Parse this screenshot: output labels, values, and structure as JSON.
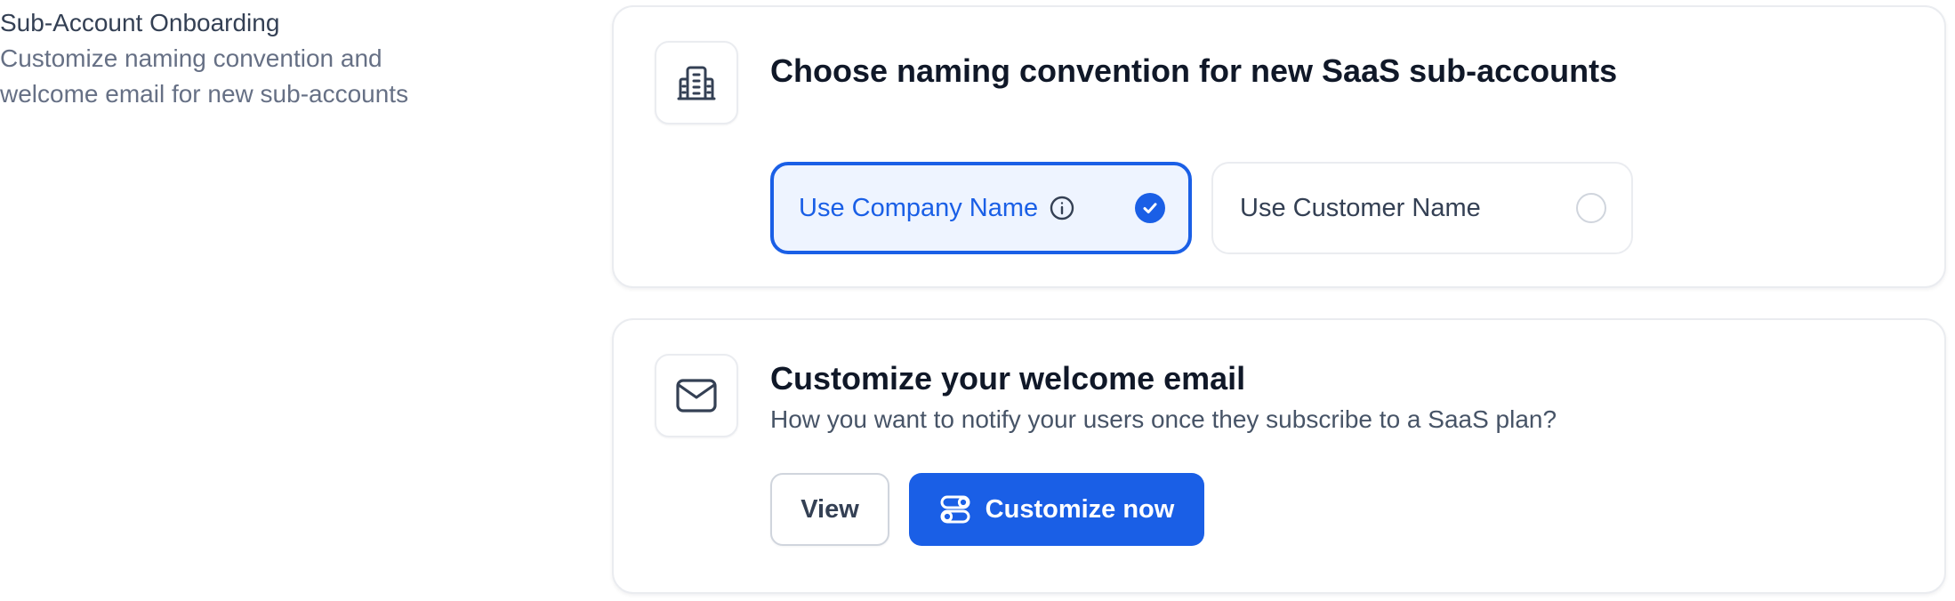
{
  "section": {
    "title": "Sub-Account Onboarding",
    "description_line1": "Customize naming convention and",
    "description_line2": "welcome email for new sub-accounts"
  },
  "naming_card": {
    "icon": "building-icon",
    "title": "Choose naming convention for new SaaS sub-accounts",
    "options": [
      {
        "label": "Use Company Name",
        "selected": true,
        "has_info_icon": true
      },
      {
        "label": "Use Customer Name",
        "selected": false,
        "has_info_icon": false
      }
    ]
  },
  "email_card": {
    "icon": "mail-icon",
    "title": "Customize your welcome email",
    "subtitle": "How you want to notify your users once they subscribe to a SaaS plan?",
    "view_button_label": "View",
    "customize_button_label": "Customize now",
    "customize_button_icon": "toggles-icon"
  },
  "colors": {
    "accent": "#1a5fe6",
    "selected_bg": "#eef4ff",
    "border": "#eaecf0",
    "heading": "#101828",
    "muted": "#667085"
  }
}
